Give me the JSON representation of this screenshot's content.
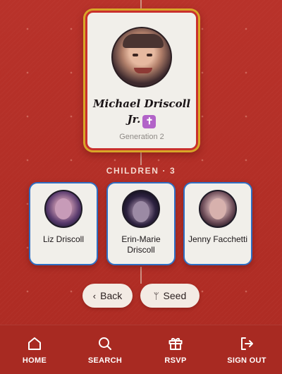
{
  "focus_person": {
    "name": "Michael Driscoll Jr.",
    "generation": "Generation 2",
    "badge_icon": "latin-cross-icon"
  },
  "children_section": {
    "label": "CHILDREN · 3"
  },
  "children": [
    {
      "name": "Liz Driscoll"
    },
    {
      "name": "Erin-Marie Driscoll"
    },
    {
      "name": "Jenny Facchetti"
    }
  ],
  "actions": {
    "back_label": "Back",
    "back_icon_char": "‹",
    "seed_label": "Seed",
    "seed_icon_char": "ᛘ"
  },
  "nav": {
    "items": [
      {
        "label": "HOME",
        "icon": "home-icon"
      },
      {
        "label": "SEARCH",
        "icon": "search-icon"
      },
      {
        "label": "RSVP",
        "icon": "gift-icon"
      },
      {
        "label": "SIGN OUT",
        "icon": "sign-out-icon"
      }
    ]
  },
  "colors": {
    "background": "#b42e25",
    "focus_border_outer": "#d8a628",
    "focus_border_inner": "#c9302c",
    "child_border": "#2f6fc4",
    "badge": "#b263c8",
    "card_bg": "#f1efea"
  }
}
